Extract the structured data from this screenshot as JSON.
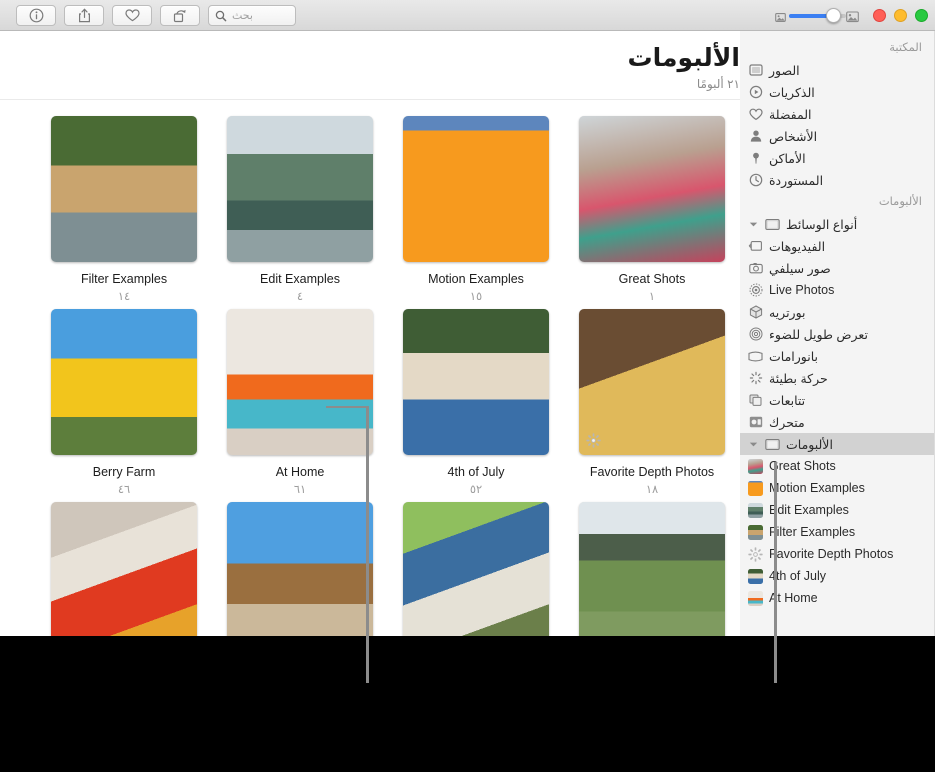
{
  "window": {
    "title": "الألبومات",
    "traffic_lights": [
      "green-button",
      "yellow-button",
      "red-button"
    ]
  },
  "toolbar": {
    "search_placeholder": "بحث",
    "buttons": [
      {
        "name": "search-field",
        "label": "بحث",
        "icon": "search-icon"
      },
      {
        "name": "rotate-button",
        "label": "",
        "icon": "rotate-icon"
      },
      {
        "name": "favorite-button",
        "label": "",
        "icon": "heart-icon"
      },
      {
        "name": "share-button",
        "label": "",
        "icon": "share-icon"
      },
      {
        "name": "info-button",
        "label": "",
        "icon": "info-icon"
      }
    ],
    "zoom_slider": {
      "name": "thumbnail-size-slider",
      "value": 45,
      "min_icon": "small-photo-icon",
      "max_icon": "large-photo-icon",
      "accent_color": "#3b7ff2"
    }
  },
  "sidebar": {
    "sections": [
      {
        "header": "المكتبة",
        "items": [
          {
            "label": "الصور",
            "icon": "photos-icon"
          },
          {
            "label": "الذكريات",
            "icon": "memories-icon"
          },
          {
            "label": "المفضلة",
            "icon": "heart-icon"
          },
          {
            "label": "الأشخاص",
            "icon": "person-icon"
          },
          {
            "label": "الأماكن",
            "icon": "pin-icon"
          },
          {
            "label": "المستوردة",
            "icon": "clock-icon"
          }
        ]
      },
      {
        "header": "الألبومات",
        "items": [
          {
            "label": "أنواع الوسائط",
            "icon": "folder-icon",
            "disclosure": "chevron-down-icon"
          },
          {
            "label": "الفيديوهات",
            "icon": "video-icon"
          },
          {
            "label": "صور سيلفي",
            "icon": "selfie-camera-icon"
          },
          {
            "label": "Live Photos",
            "icon": "live-photo-icon"
          },
          {
            "label": "بورتريه",
            "icon": "portrait-cube-icon"
          },
          {
            "label": "تعرض طويل للضوء",
            "icon": "long-exposure-icon"
          },
          {
            "label": "بانورامات",
            "icon": "panorama-icon"
          },
          {
            "label": "حركة بطيئة",
            "icon": "slow-motion-icon"
          },
          {
            "label": "تتابعات",
            "icon": "burst-icon"
          },
          {
            "label": "متحرك",
            "icon": "animated-icon"
          }
        ]
      }
    ],
    "albums_group": {
      "label": "الألبومات",
      "icon": "folder-icon",
      "disclosure": "chevron-down-icon",
      "selected": true,
      "items": [
        {
          "label": "Great Shots",
          "thumb": "woman-floral"
        },
        {
          "label": "Motion Examples",
          "thumb": "orange-wall"
        },
        {
          "label": "Edit Examples",
          "thumb": "cliff-coast"
        },
        {
          "label": "Filter Examples",
          "thumb": "dog-river"
        },
        {
          "label": "Favorite Depth Photos",
          "thumb": "gear-icon"
        },
        {
          "label": "4th of July",
          "thumb": "picnic-table"
        },
        {
          "label": "At Home",
          "thumb": "girl-tutu"
        }
      ]
    }
  },
  "main": {
    "title": "الألبومات",
    "subtitle": "٢١ ألبومًا",
    "albums": [
      {
        "name": "Great Shots",
        "count": "١",
        "thumb": "woman-floral",
        "badge": null
      },
      {
        "name": "Motion Examples",
        "count": "١٥",
        "thumb": "orange-wall",
        "badge": null
      },
      {
        "name": "Edit Examples",
        "count": "٤",
        "thumb": "cliff-coast",
        "badge": null
      },
      {
        "name": "Filter Examples",
        "count": "١٤",
        "thumb": "dog-river",
        "badge": null
      },
      {
        "name": "Favorite Depth Photos",
        "count": "١٨",
        "thumb": "dog-blanket",
        "badge": "depth-gear-icon"
      },
      {
        "name": "4th of July",
        "count": "٥٢",
        "thumb": "picnic-table",
        "badge": null
      },
      {
        "name": "At Home",
        "count": "٦١",
        "thumb": "girl-tutu",
        "badge": null
      },
      {
        "name": "Berry Farm",
        "count": "٤٦",
        "thumb": "yellow-truck",
        "badge": null
      },
      {
        "name": "",
        "count": "",
        "thumb": "coast-flowers",
        "badge": null
      },
      {
        "name": "",
        "count": "",
        "thumb": "family-party",
        "badge": null
      },
      {
        "name": "",
        "count": "",
        "thumb": "family-beach",
        "badge": null
      },
      {
        "name": "",
        "count": "",
        "thumb": "girl-guitar",
        "badge": null
      }
    ]
  },
  "annotations": {
    "leader_line_color": "#8c8c8c",
    "lines": [
      "callout-line-album-thumbnail",
      "callout-line-sidebar-albums"
    ]
  }
}
